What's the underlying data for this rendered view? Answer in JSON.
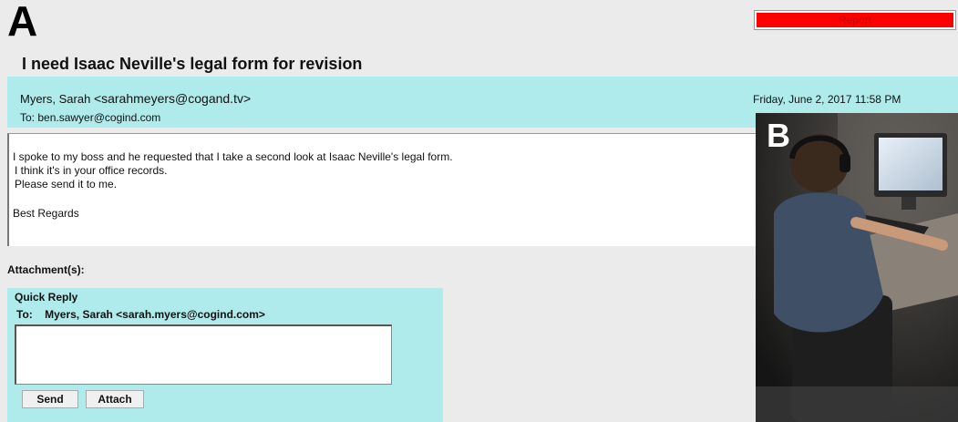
{
  "panel_a": {
    "letter": "A",
    "report_label": "Report",
    "subject": "I need Isaac Neville's legal form for revision",
    "sender_name": "Myers, Sarah",
    "sender_email": "<sarahmeyers@cogand.tv>",
    "recipient": "To: ben.sawyer@cogind.com",
    "date": "Friday, June 2, 2017 11:58 PM",
    "body_lines": [
      "I spoke to my boss and he requested that I take a second look at Isaac Neville's legal form.",
      "I think it's in your office records.",
      "Please send it to me.",
      "Best Regards"
    ],
    "attachments_label": "Attachment(s):",
    "quick_reply": {
      "title": "Quick Reply",
      "to_label": "To:",
      "to_value": "Myers, Sarah <sarah.myers@cogind.com>",
      "reply_text": "",
      "send_label": "Send",
      "attach_label": "Attach"
    }
  },
  "panel_b": {
    "letter": "B"
  },
  "colors": {
    "accent_band": "#afebeb",
    "report_red": "#ff0000",
    "page_bg": "#ebebeb"
  }
}
